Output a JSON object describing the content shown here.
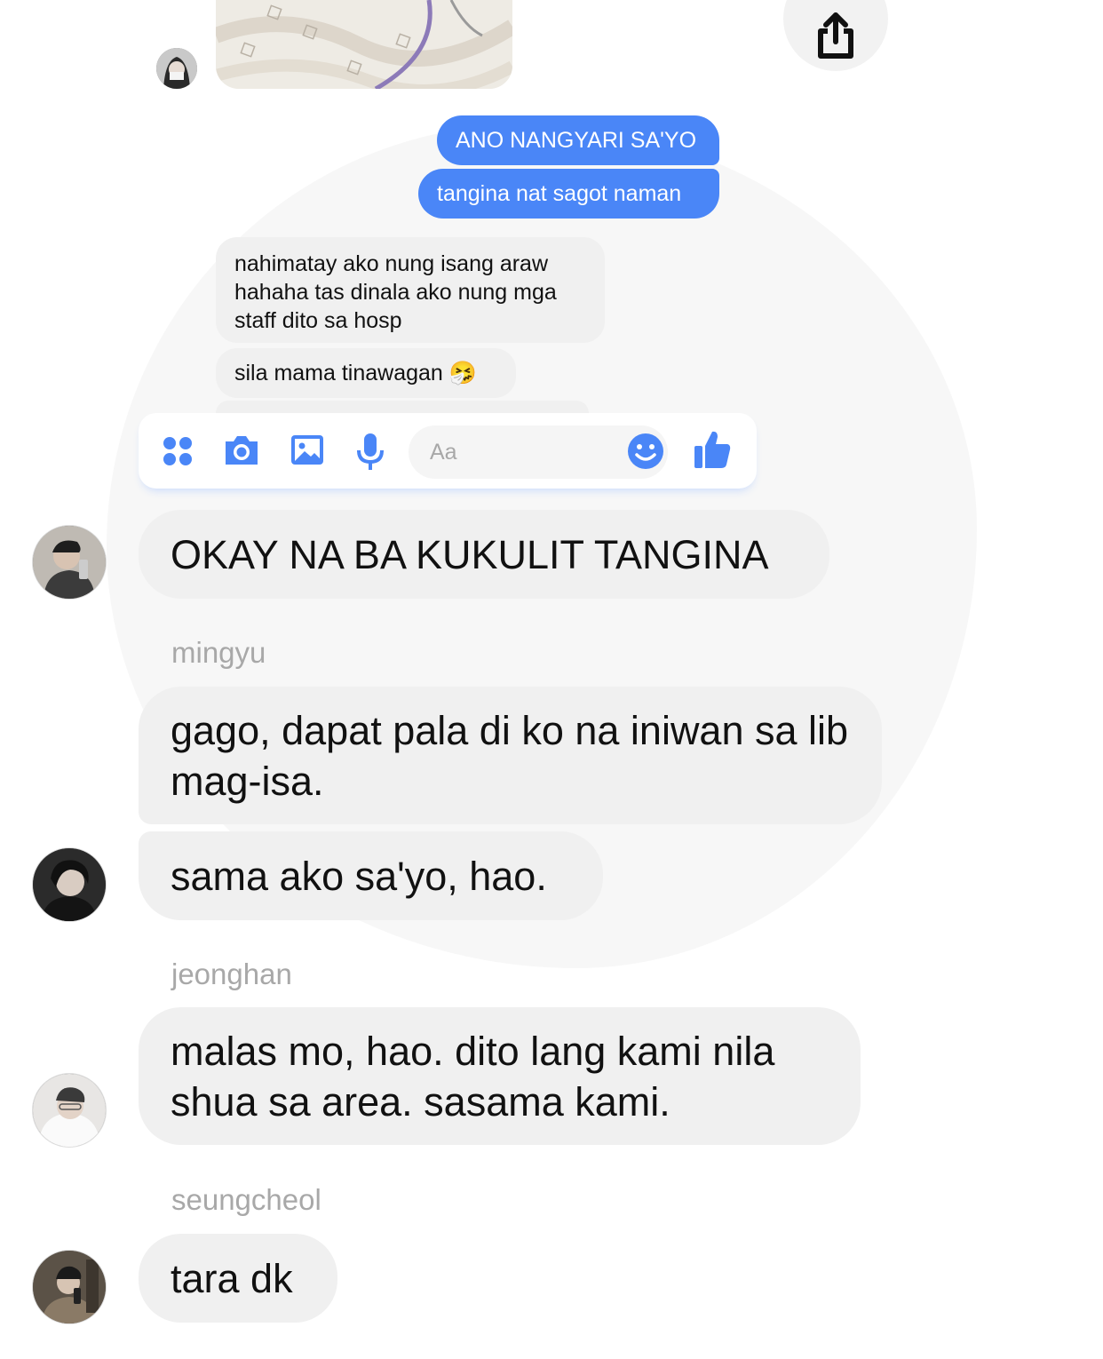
{
  "top_thread": {
    "sent_messages": [
      "ANO NANGYARI SA'YO",
      "tangina nat sagot naman"
    ],
    "received_messages": [
      "nahimatay ako nung isang araw hahaha tas dinala ako nung mga staff dito sa hosp",
      "sila mama tinawagan 🤧"
    ]
  },
  "composer": {
    "placeholder": "Aa",
    "icons": [
      "apps-icon",
      "camera-icon",
      "gallery-icon",
      "microphone-icon",
      "emoji-icon",
      "thumbs-up-icon"
    ]
  },
  "conversation": [
    {
      "sender": "",
      "text": "OKAY NA BA KUKULIT TANGINA"
    },
    {
      "sender": "mingyu",
      "text": "gago, dapat pala di ko na iniwan sa lib mag-isa."
    },
    {
      "sender": "",
      "text": "sama ako sa'yo, hao."
    },
    {
      "sender": "jeonghan",
      "text": "malas mo, hao. dito lang kami nila shua sa area. sasama kami."
    },
    {
      "sender": "seungcheol",
      "text": "tara dk"
    }
  ],
  "colors": {
    "accent": "#4a86f7",
    "bubble": "#f0f0f0",
    "name": "#a8a8a8"
  }
}
